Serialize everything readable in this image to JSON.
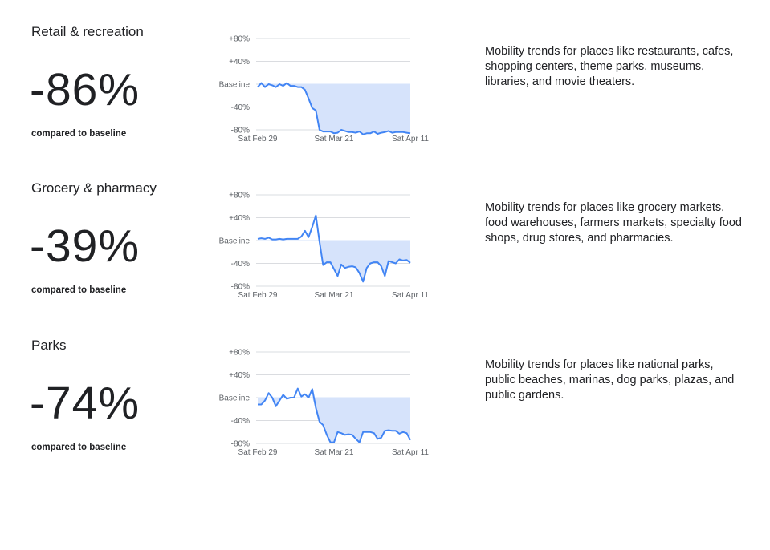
{
  "sections": [
    {
      "title": "Retail & recreation",
      "value": "-86%",
      "compared": "compared to baseline",
      "description": "Mobility trends for places like restaurants, cafes, shopping centers, theme parks, museums, libraries, and movie theaters."
    },
    {
      "title": "Grocery & pharmacy",
      "value": "-39%",
      "compared": "compared to baseline",
      "description": "Mobility trends for places like grocery markets, food warehouses, farmers markets, specialty food shops, drug stores, and pharmacies."
    },
    {
      "title": "Parks",
      "value": "-74%",
      "compared": "compared to baseline",
      "description": "Mobility trends for places like national parks, public beaches, marinas, dog parks, plazas, and public gardens."
    }
  ],
  "colors": {
    "line": "#4285f4",
    "fill": "#d6e3fb",
    "grid": "#dadce0",
    "text": "#202124",
    "tick": "#5f6368"
  },
  "chart_data": [
    {
      "type": "area",
      "ylim": [
        -80,
        80
      ],
      "yticks": [
        "+80%",
        "+40%",
        "Baseline",
        "-40%",
        "-80%"
      ],
      "xticks": [
        "Sat Feb 29",
        "Sat Mar 21",
        "Sat Apr 11"
      ],
      "x": [
        "2020-02-29",
        "2020-03-01",
        "2020-03-02",
        "2020-03-03",
        "2020-03-04",
        "2020-03-05",
        "2020-03-06",
        "2020-03-07",
        "2020-03-08",
        "2020-03-09",
        "2020-03-10",
        "2020-03-11",
        "2020-03-12",
        "2020-03-13",
        "2020-03-14",
        "2020-03-15",
        "2020-03-16",
        "2020-03-17",
        "2020-03-18",
        "2020-03-19",
        "2020-03-20",
        "2020-03-21",
        "2020-03-22",
        "2020-03-23",
        "2020-03-24",
        "2020-03-25",
        "2020-03-26",
        "2020-03-27",
        "2020-03-28",
        "2020-03-29",
        "2020-03-30",
        "2020-03-31",
        "2020-04-01",
        "2020-04-02",
        "2020-04-03",
        "2020-04-04",
        "2020-04-05",
        "2020-04-06",
        "2020-04-07",
        "2020-04-08",
        "2020-04-09",
        "2020-04-10",
        "2020-04-11"
      ],
      "series": [
        {
          "values": [
            -5,
            2,
            -5,
            0,
            -2,
            -5,
            0,
            -3,
            2,
            -3,
            -3,
            -5,
            -5,
            -10,
            -25,
            -42,
            -46,
            -80,
            -83,
            -83,
            -83,
            -86,
            -85,
            -80,
            -82,
            -84,
            -84,
            -85,
            -83,
            -88,
            -86,
            -86,
            -83,
            -87,
            -85,
            -84,
            -82,
            -85,
            -84,
            -84,
            -84,
            -85,
            -86
          ]
        }
      ]
    },
    {
      "type": "area",
      "ylim": [
        -80,
        80
      ],
      "yticks": [
        "+80%",
        "+40%",
        "Baseline",
        "-40%",
        "-80%"
      ],
      "xticks": [
        "Sat Feb 29",
        "Sat Mar 21",
        "Sat Apr 11"
      ],
      "x": [
        "2020-02-29",
        "2020-03-01",
        "2020-03-02",
        "2020-03-03",
        "2020-03-04",
        "2020-03-05",
        "2020-03-06",
        "2020-03-07",
        "2020-03-08",
        "2020-03-09",
        "2020-03-10",
        "2020-03-11",
        "2020-03-12",
        "2020-03-13",
        "2020-03-14",
        "2020-03-15",
        "2020-03-16",
        "2020-03-17",
        "2020-03-18",
        "2020-03-19",
        "2020-03-20",
        "2020-03-21",
        "2020-03-22",
        "2020-03-23",
        "2020-03-24",
        "2020-03-25",
        "2020-03-26",
        "2020-03-27",
        "2020-03-28",
        "2020-03-29",
        "2020-03-30",
        "2020-03-31",
        "2020-04-01",
        "2020-04-02",
        "2020-04-03",
        "2020-04-04",
        "2020-04-05",
        "2020-04-06",
        "2020-04-07",
        "2020-04-08",
        "2020-04-09",
        "2020-04-10",
        "2020-04-11"
      ],
      "series": [
        {
          "values": [
            3,
            4,
            3,
            5,
            2,
            2,
            3,
            2,
            3,
            3,
            3,
            3,
            7,
            17,
            6,
            24,
            44,
            -2,
            -43,
            -38,
            -38,
            -50,
            -62,
            -42,
            -48,
            -46,
            -45,
            -47,
            -57,
            -72,
            -48,
            -40,
            -38,
            -38,
            -45,
            -62,
            -36,
            -38,
            -40,
            -33,
            -35,
            -34,
            -39
          ]
        }
      ]
    },
    {
      "type": "area",
      "ylim": [
        -80,
        80
      ],
      "yticks": [
        "+80%",
        "+40%",
        "Baseline",
        "-40%",
        "-80%"
      ],
      "xticks": [
        "Sat Feb 29",
        "Sat Mar 21",
        "Sat Apr 11"
      ],
      "x": [
        "2020-02-29",
        "2020-03-01",
        "2020-03-02",
        "2020-03-03",
        "2020-03-04",
        "2020-03-05",
        "2020-03-06",
        "2020-03-07",
        "2020-03-08",
        "2020-03-09",
        "2020-03-10",
        "2020-03-11",
        "2020-03-12",
        "2020-03-13",
        "2020-03-14",
        "2020-03-15",
        "2020-03-16",
        "2020-03-17",
        "2020-03-18",
        "2020-03-19",
        "2020-03-20",
        "2020-03-21",
        "2020-03-22",
        "2020-03-23",
        "2020-03-24",
        "2020-03-25",
        "2020-03-26",
        "2020-03-27",
        "2020-03-28",
        "2020-03-29",
        "2020-03-30",
        "2020-03-31",
        "2020-04-01",
        "2020-04-02",
        "2020-04-03",
        "2020-04-04",
        "2020-04-05",
        "2020-04-06",
        "2020-04-07",
        "2020-04-08",
        "2020-04-09",
        "2020-04-10",
        "2020-04-11"
      ],
      "series": [
        {
          "values": [
            -12,
            -12,
            -5,
            8,
            0,
            -15,
            -5,
            5,
            -2,
            0,
            0,
            16,
            2,
            6,
            0,
            15,
            -18,
            -42,
            -48,
            -65,
            -78,
            -78,
            -60,
            -62,
            -65,
            -64,
            -65,
            -72,
            -78,
            -60,
            -60,
            -60,
            -62,
            -72,
            -70,
            -58,
            -57,
            -58,
            -58,
            -63,
            -60,
            -62,
            -74
          ]
        }
      ]
    }
  ]
}
